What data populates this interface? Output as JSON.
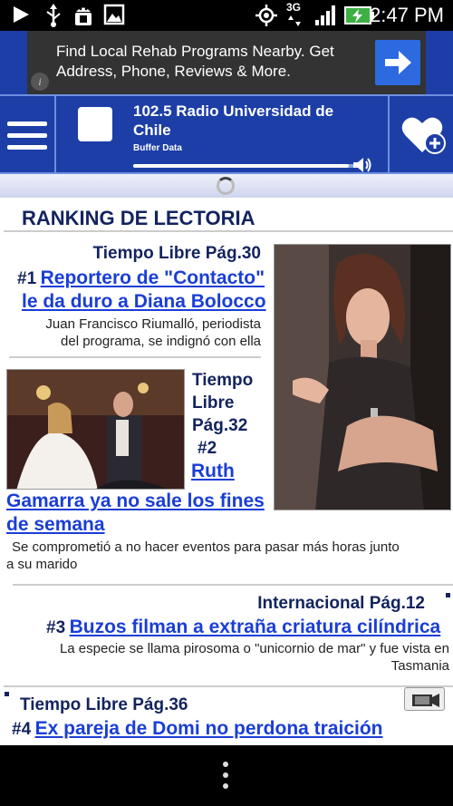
{
  "status_bar": {
    "time": "2:47 PM",
    "network": "3G",
    "icons": [
      "play-icon",
      "usb-icon",
      "android-debug-icon",
      "image-icon",
      "gps-icon",
      "signal-icon",
      "battery-charging-icon"
    ]
  },
  "ad": {
    "text": "Find Local Rehab Programs Nearby. Get Address, Phone, Reviews & More.",
    "info": "i",
    "button_icon": "arrow-right-icon"
  },
  "player": {
    "station": "102.5 Radio Universidad de Chile",
    "buffer": "Buffer Data",
    "volume_level": 0.97
  },
  "content": {
    "heading": "RANKING DE LECTORIA",
    "articles": [
      {
        "section": "Tiempo Libre Pág.30",
        "rank": "#1",
        "title_line1": " Reportero de \"Contacto\"",
        "title_line2": "le da duro a Diana Bolocco ",
        "desc_line1": "Juan Francisco Riumalló, periodista",
        "desc_line2": "del programa, se indignó con ella"
      },
      {
        "section_line1": "Tiempo",
        "section_line2": "Libre",
        "section_line3": "Pág.32",
        "rank": "#2",
        "title_line1": " Ruth",
        "title_line2": "Gamarra ya no sale los fines",
        "title_line3": "de semana ",
        "desc_line1": "Se comprometió a no hacer eventos para pasar más horas junto",
        "desc_line2": "a su marido"
      },
      {
        "section": "Internacional Pág.12",
        "rank": "#3",
        "title": " Buzos filman a extraña criatura cilíndrica",
        "desc_line1": "La especie se llama pirosoma o \"unicornio de mar\" y fue vista en",
        "desc_line2": "Tasmania"
      },
      {
        "section": "Tiempo Libre Pág.36",
        "rank": "#4",
        "title": " Ex pareja de Domi no perdona traición"
      }
    ]
  }
}
